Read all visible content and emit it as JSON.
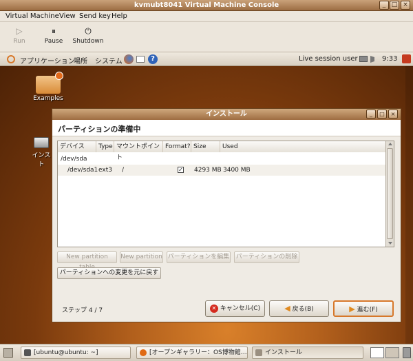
{
  "window": {
    "title": "kvmubt8041 Virtual Machine Console",
    "controls": [
      "_",
      "□",
      "×"
    ]
  },
  "menu": {
    "items": [
      "Virtual Machine",
      "View",
      "Send key",
      "Help"
    ]
  },
  "toolbar": {
    "buttons": [
      {
        "label": "Run",
        "icon": "▷",
        "enabled": false
      },
      {
        "label": "Pause",
        "icon": "⏸",
        "enabled": true
      },
      {
        "label": "Shutdown",
        "icon": "⏻",
        "enabled": true
      }
    ]
  },
  "guest_panel": {
    "menus": [
      "アプリケーション",
      "場所",
      "システム"
    ],
    "session": "Live session user",
    "clock": "9:33"
  },
  "desktop": {
    "icons": [
      {
        "label": "Examples",
        "icon": "folder-icon"
      },
      {
        "label": "インスト",
        "icon": "drive-icon"
      }
    ]
  },
  "dialog": {
    "title": "インストール",
    "heading": "パーティションの準備中",
    "columns": [
      "デバイス",
      "Type",
      "マウントポイント",
      "Format?",
      "Size",
      "Used"
    ],
    "rows": [
      {
        "device": "/dev/sda",
        "type": "",
        "mount": "",
        "format": "",
        "size": "",
        "used": ""
      },
      {
        "device": "/dev/sda1",
        "type": "ext3",
        "mount": "/",
        "format": "✓",
        "size": "4293 MB",
        "used": "3400 MB"
      }
    ],
    "buttons": {
      "new_table": "New partition table",
      "new_part": "New partition",
      "edit": "パーティションを編集",
      "delete": "パーティションの削除",
      "revert": "パーティションへの変更を元に戻す"
    },
    "step": "ステップ 4 / 7",
    "cancel": "キャンセル(C)",
    "back": "戻る(B)",
    "forward": "進む(F)"
  },
  "taskbar": {
    "items": [
      "[ubuntu@ubuntu: ~]",
      "[オープンギャラリー：OS博物館…",
      "インストール"
    ]
  },
  "colors": {
    "accent": "#d7782a",
    "titlebar": "#9c6d43",
    "desktop": "#7a3a0d"
  }
}
